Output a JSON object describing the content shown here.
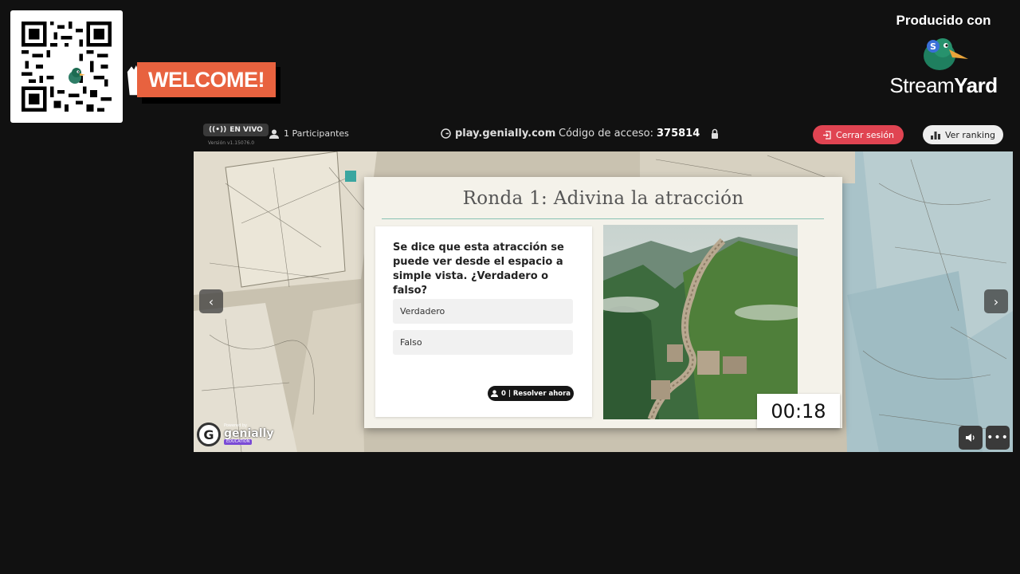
{
  "overlay": {
    "welcome_label": "WELCOME!",
    "brand_produced": "Producido con",
    "brand_name_light": "Stream",
    "brand_name_bold": "Yard"
  },
  "topbar": {
    "live_label": "EN VIVO",
    "version": "Versión v1.15076.0",
    "participants": "1 Participantes",
    "site": "play.genially.com",
    "access_label": "Código de acceso:",
    "access_code": "375814",
    "logout_label": "Cerrar sesión",
    "ranking_label": "Ver ranking"
  },
  "card": {
    "title": "Ronda 1: Adivina la atracción",
    "question": "Se dice que esta atracción se puede ver desde el espacio a simple vista. ¿Verdadero o falso?",
    "options": [
      "Verdadero",
      "Falso"
    ],
    "resolve_label": "0 | Resolver ahora",
    "timer": "00:18"
  },
  "stage": {
    "prev_icon": "‹",
    "next_icon": "›",
    "genially_powered": "Powered by",
    "genially_name": "genially",
    "genially_edition": "EDUCATION",
    "more_icon": "•••"
  },
  "colors": {
    "background": "#111111",
    "accent_red": "#e04452",
    "welcome_orange": "#e8623f",
    "card_rule": "#8ac2b4"
  }
}
